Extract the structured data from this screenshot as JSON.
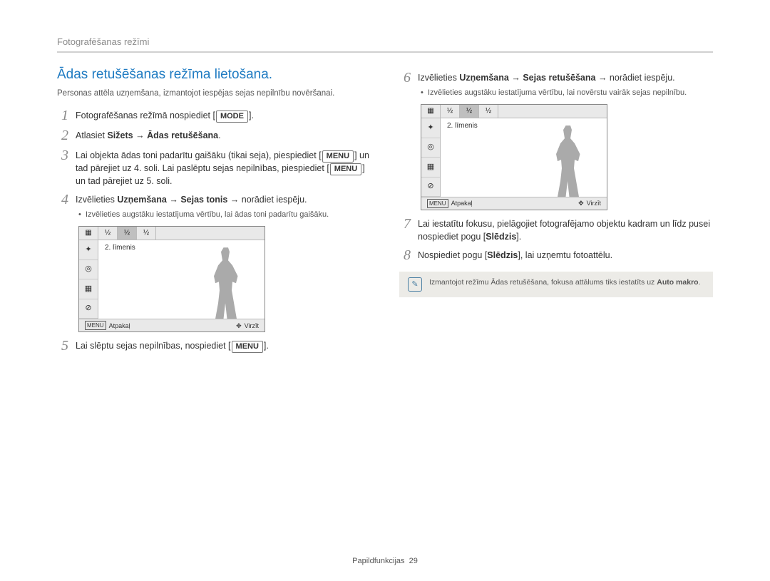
{
  "breadcrumb": "Fotografēšanas režīmi",
  "section_title": "Ādas retušēšanas režīma lietošana.",
  "subtitle": "Personas attēla uzņemšana, izmantojot iespējas sejas nepilnību novēršanai.",
  "keys": {
    "mode": "MODE",
    "menu": "MENU"
  },
  "arrow": "→",
  "steps_left": {
    "s1": {
      "num": "1",
      "pre": "Fotografēšanas režīmā nospiediet ",
      "post": "."
    },
    "s2": {
      "num": "2",
      "a": "Atlasiet ",
      "b": "Sižets",
      "c": "Ādas retušēšana",
      "d": "."
    },
    "s3": {
      "num": "3",
      "a": "Lai objekta ādas toni padarītu gaišāku (tikai seja), piespiediet ",
      "b": " un tad pārejiet uz 4. soli. Lai paslēptu sejas nepilnības, piespiediet ",
      "c": " un tad pārejiet uz 5. soli."
    },
    "s4": {
      "num": "4",
      "a": "Izvēlieties ",
      "b": "Uzņemšana",
      "c": "Sejas tonis",
      "d": " norādiet iespēju.",
      "sub": "Izvēlieties augstāku iestatījuma vērtību, lai ādas toni padarītu gaišāku."
    },
    "s5": {
      "num": "5",
      "a": "Lai slēptu sejas nepilnības, nospiediet ",
      "b": "."
    }
  },
  "steps_right": {
    "s6": {
      "num": "6",
      "a": "Izvēlieties ",
      "b": "Uzņemšana",
      "c": "Sejas retušēšana",
      "d": " norādiet iespēju.",
      "sub": "Izvēlieties augstāku iestatījuma vērtību, lai novērstu vairāk sejas nepilnību."
    },
    "s7": {
      "num": "7",
      "a": "Lai iestatītu fokusu, pielāgojiet fotografējamo objektu kadram un līdz pusei nospiediet pogu [",
      "b": "Slēdzis",
      "c": "]."
    },
    "s8": {
      "num": "8",
      "a": "Nospiediet pogu [",
      "b": "Slēdzis",
      "c": "], lai uzņemtu fotoattēlu."
    }
  },
  "lcd": {
    "level": "2. līmenis",
    "back_key": "MENU",
    "back": "Atpakaļ",
    "move": "Virzīt",
    "tabs": [
      "⅟₁",
      "⅟₂",
      "⅟₃"
    ]
  },
  "note": {
    "text": "Izmantojot režīmu Ādas retušēšana, fokusa attālums tiks iestatīts uz ",
    "bold": "Auto makro",
    "tail": "."
  },
  "footer": {
    "label": "Papildfunkcijas",
    "page": "29"
  }
}
